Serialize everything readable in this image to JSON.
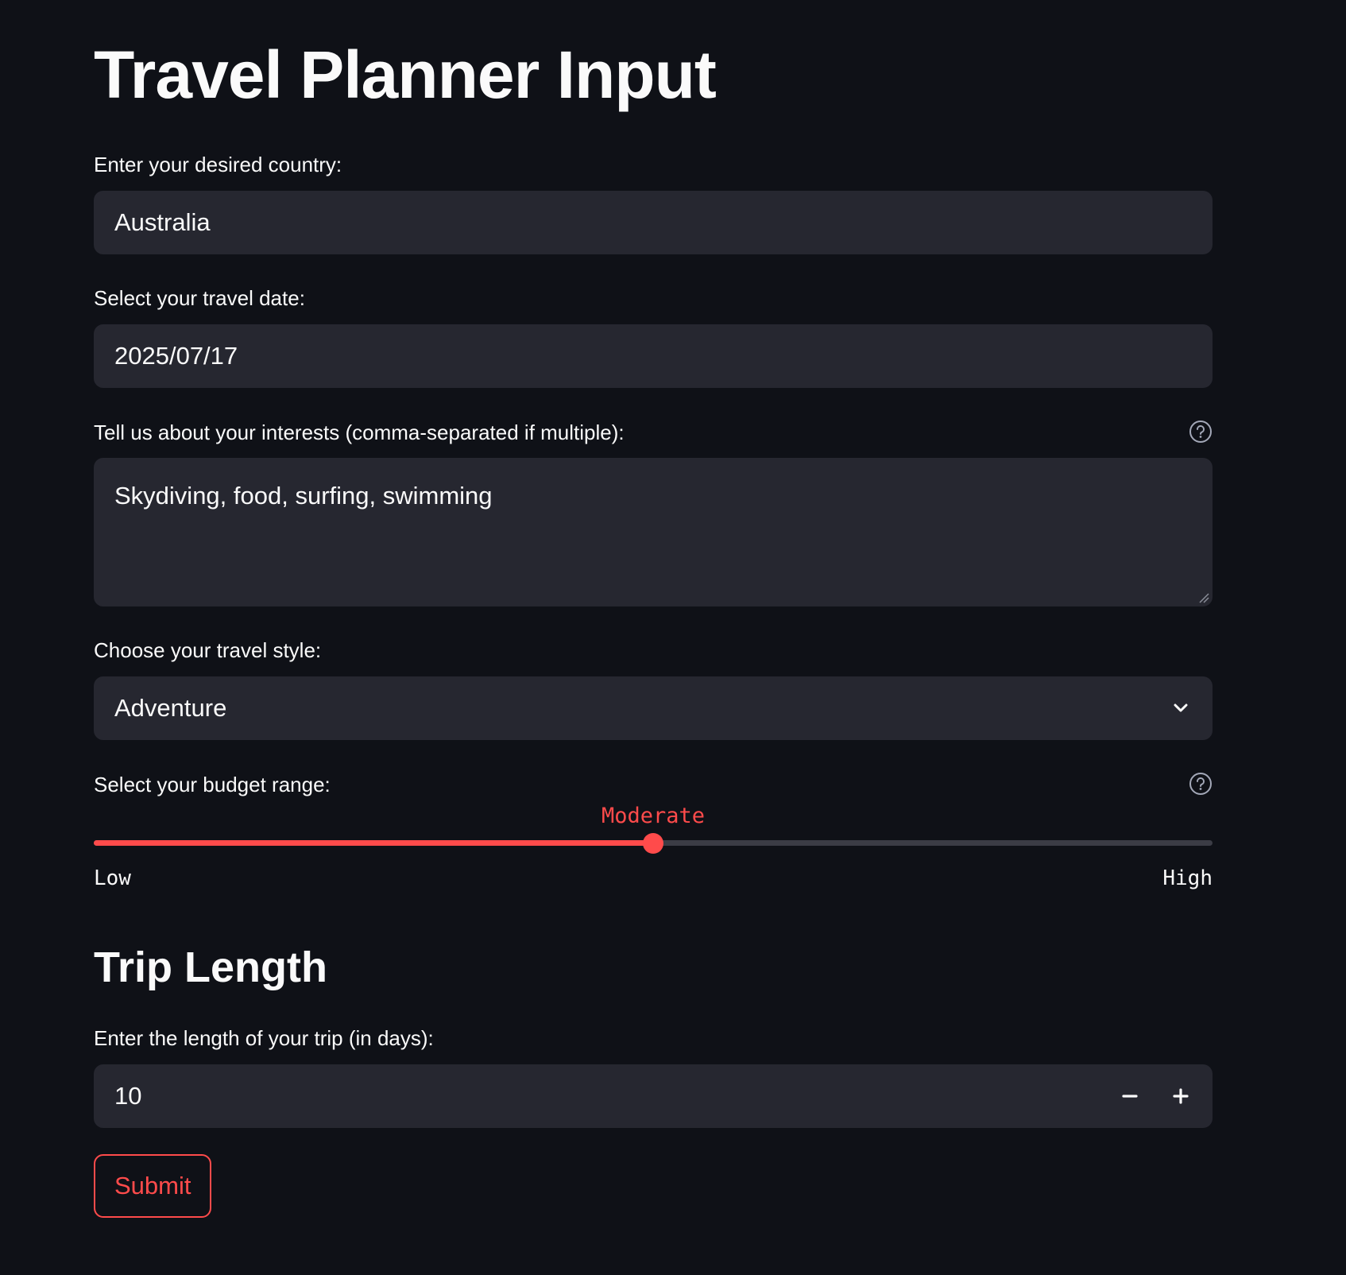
{
  "page": {
    "title": "Travel Planner Input"
  },
  "country": {
    "label": "Enter your desired country:",
    "value": "Australia"
  },
  "travel_date": {
    "label": "Select your travel date:",
    "value": "2025/07/17"
  },
  "interests": {
    "label": "Tell us about your interests (comma-separated if multiple):",
    "value": "Skydiving, food, surfing, swimming",
    "help_icon": "help-circle-icon"
  },
  "travel_style": {
    "label": "Choose your travel style:",
    "selected": "Adventure",
    "icon": "chevron-down-icon"
  },
  "budget": {
    "label": "Select your budget range:",
    "value": "Moderate",
    "min_label": "Low",
    "max_label": "High",
    "position": 0.5,
    "help_icon": "help-circle-icon"
  },
  "trip_section": {
    "heading": "Trip Length"
  },
  "trip_length": {
    "label": "Enter the length of your trip (in days):",
    "value": "10",
    "decrement_icon": "minus-icon",
    "increment_icon": "plus-icon"
  },
  "submit": {
    "label": "Submit"
  },
  "colors": {
    "background": "#0f1117",
    "field": "#262730",
    "accent": "#ff4b4b",
    "text": "#fafafa"
  }
}
